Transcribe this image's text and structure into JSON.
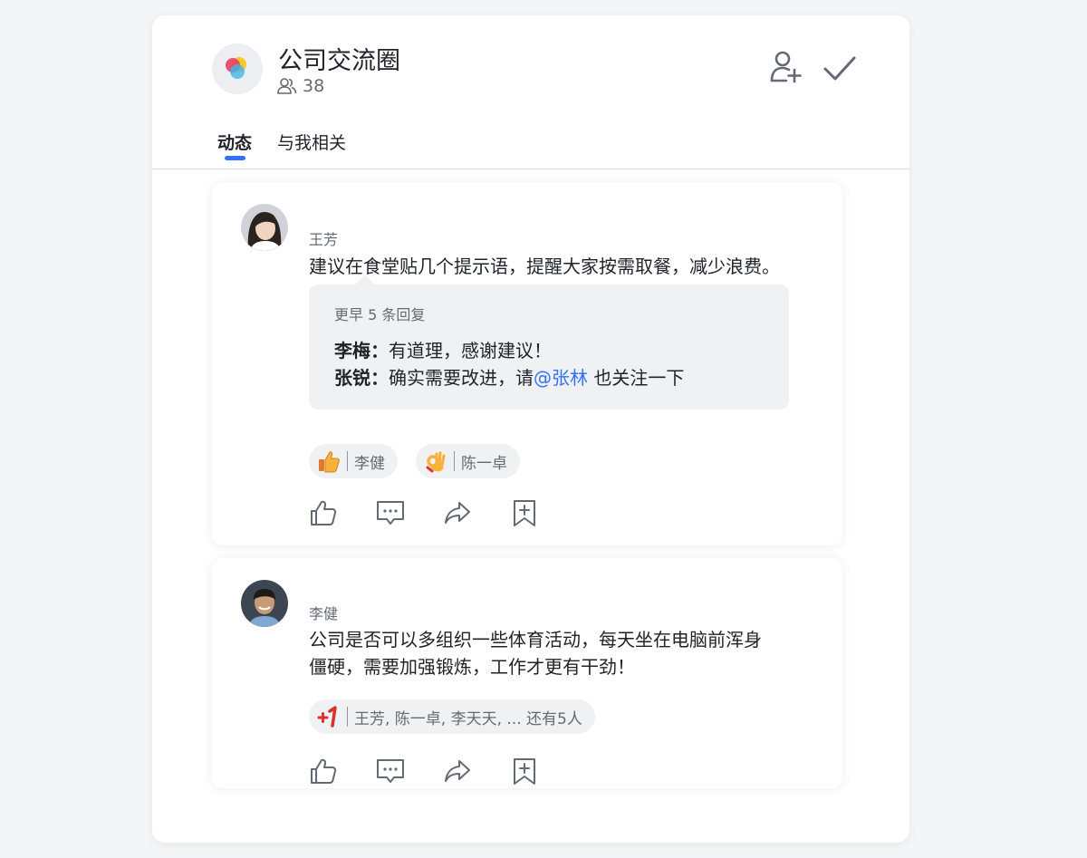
{
  "header": {
    "title": "公司交流圈",
    "member_count": "38"
  },
  "tabs": [
    {
      "label": "动态",
      "active": true
    },
    {
      "label": "与我相关",
      "active": false
    }
  ],
  "posts": [
    {
      "author": "王芳",
      "text": "建议在食堂贴几个提示语，提醒大家按需取餐，减少浪费。",
      "replies": {
        "earlier_label": "更早 5 条回复",
        "items": [
          {
            "author": "李梅：",
            "text": "有道理，感谢建议！"
          },
          {
            "author": "张锐：",
            "text_before": "确实需要改进，请",
            "mention": "@张林",
            "text_after": " 也关注一下"
          }
        ]
      },
      "reactions": [
        {
          "icon": "thumbs-up-emoji",
          "users": "李健"
        },
        {
          "icon": "ok-hand-emoji",
          "users": "陈一卓"
        }
      ]
    },
    {
      "author": "李健",
      "text_lines": [
        "公司是否可以多组织一些体育活动，每天坐在电脑前浑身",
        "僵硬，需要加强锻炼，工作才更有干劲！"
      ],
      "reactions": [
        {
          "icon": "plus-one-emoji",
          "users": "王芳, 陈一卓, 李天天, ... 还有5人"
        }
      ]
    }
  ],
  "colors": {
    "accent": "#3370ff",
    "text_primary": "#1f2329",
    "text_secondary": "#646a73",
    "reply_bg": "#f0f1f3"
  }
}
